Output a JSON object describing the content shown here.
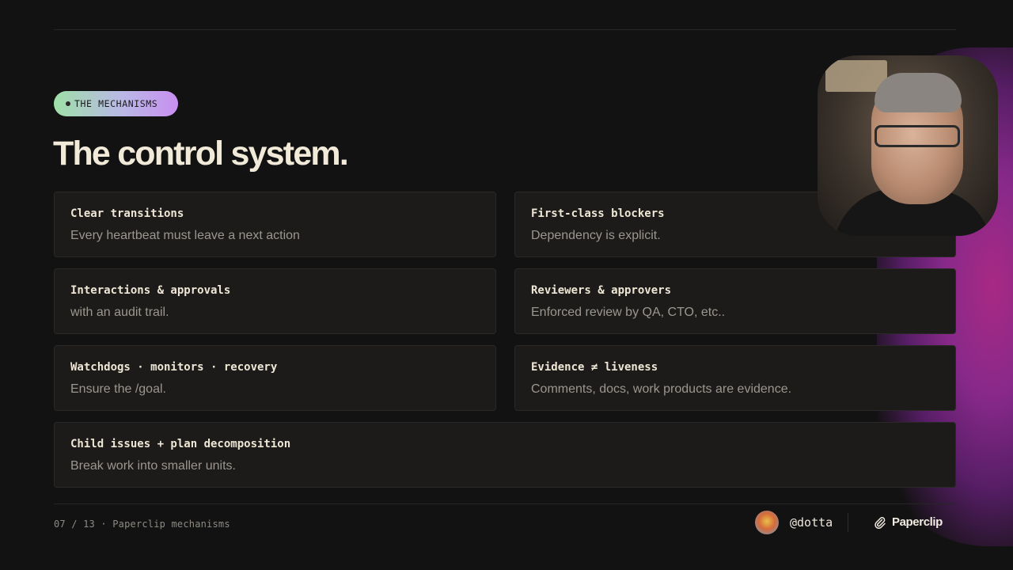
{
  "badge": {
    "label": "THE MECHANISMS"
  },
  "title": "The control system.",
  "cards": [
    {
      "heading": "Clear transitions",
      "desc": "Every heartbeat must leave a next action"
    },
    {
      "heading": "First-class blockers",
      "desc": "Dependency is explicit."
    },
    {
      "heading": "Interactions & approvals",
      "desc": "with an audit trail."
    },
    {
      "heading": "Reviewers & approvers",
      "desc": "Enforced review by QA, CTO, etc.."
    },
    {
      "heading": "Watchdogs · monitors · recovery",
      "desc": "Ensure the /goal."
    },
    {
      "heading": "Evidence ≠ liveness",
      "desc": "Comments, docs, work products are evidence."
    },
    {
      "heading": "Child issues + plan decomposition",
      "desc": "Break work into smaller units."
    }
  ],
  "footer": {
    "pagination": "07 / 13 · Paperclip mechanisms",
    "handle": "@dotta",
    "brand": "Paperclip"
  },
  "icons": {
    "brand_icon": "paperclip-icon",
    "avatar": "user-avatar"
  },
  "colors": {
    "background": "#121212",
    "heading": "#efe7d6",
    "muted": "#9b978f",
    "glow": "#b02a8a"
  }
}
